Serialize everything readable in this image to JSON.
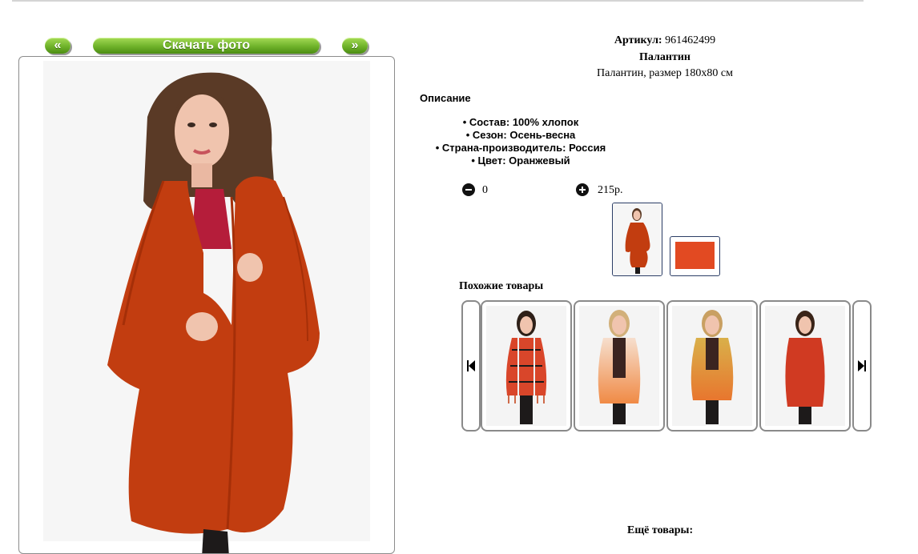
{
  "nav": {
    "prev_label": "«",
    "download_label": "Скачать фото",
    "next_label": "»"
  },
  "product": {
    "article_label": "Артикул:",
    "article_value": "961462499",
    "name": "Палантин",
    "subtitle": "Палантин, размер 180х80 см",
    "description_title": "Описание",
    "properties": [
      "Состав: 100% хлопок",
      "Сезон: Осень-весна",
      "Страна-производитель: Россия",
      "Цвет: Оранжевый"
    ],
    "quantity": "0",
    "price": "215р."
  },
  "colors": {
    "scarf": "#c23d10",
    "accent_green": "#6fb22a",
    "swatch": "#e24a22"
  },
  "similar": {
    "title": "Похожие товары",
    "items": [
      {
        "icon": "plaid-scarf-photo"
      },
      {
        "icon": "peach-gradient-scarf-photo"
      },
      {
        "icon": "mustard-orange-scarf-photo"
      },
      {
        "icon": "red-scarf-photo"
      }
    ]
  },
  "more": {
    "title": "Ещё товары:"
  }
}
